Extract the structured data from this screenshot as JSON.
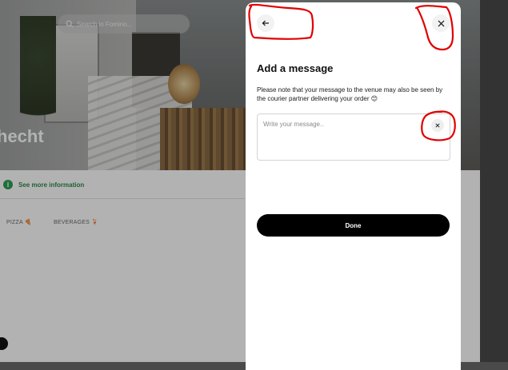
{
  "background_page": {
    "search_placeholder": "Search in Fomino...",
    "hero_title": "hecht",
    "info_link": "See more information",
    "categories": [
      {
        "label": "PIZZA 🍕"
      },
      {
        "label": "BEVERAGES 🍹"
      }
    ]
  },
  "modal": {
    "title": "Add a message",
    "note": "Please note that your message to the venue may also be seen by the courier partner delivering your order 😊",
    "message_placeholder": "Write your message..",
    "done_label": "Done"
  },
  "colors": {
    "accent_green": "#2aa055",
    "annotation_red": "#e00000",
    "primary_button": "#000000"
  },
  "icons": {
    "back": "arrow-left-icon",
    "close": "close-icon",
    "clear": "close-icon",
    "info": "info-icon",
    "search": "search-icon"
  }
}
